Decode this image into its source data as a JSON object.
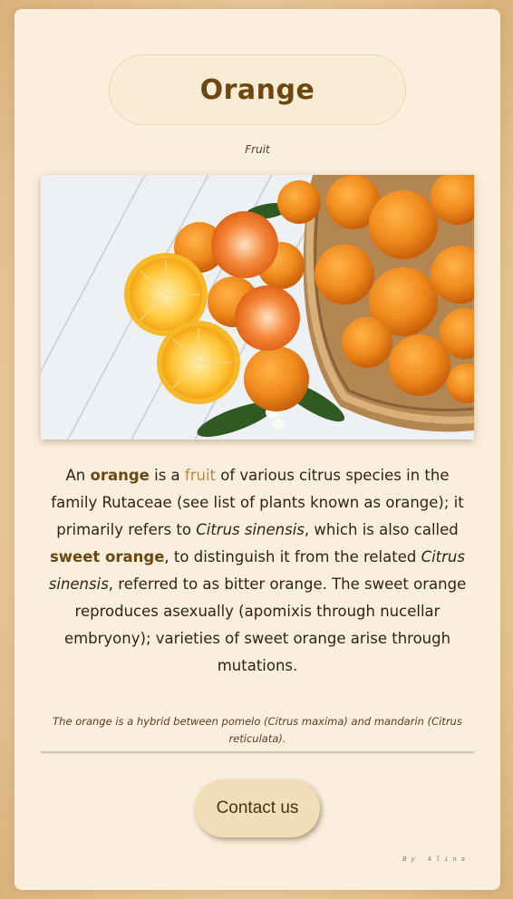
{
  "header": {
    "title": "Orange",
    "subtitle": "Fruit"
  },
  "image": {
    "alt_subject": "orange-fruits-basket"
  },
  "description": {
    "p1": "An ",
    "b1": "orange",
    "p2": " is a ",
    "link": "fruit",
    "p3": " of various citrus species in the family Rutaceae (see list of plants known as orange); it primarily refers to ",
    "i1": "Citrus sinensis",
    "p4": ", which is also called ",
    "b2": "sweet orange",
    "p5": ", to distinguish it from the related ",
    "i2": "Citrus sinensis",
    "p6": ", referred to as bitter orange. The sweet orange reproduces asexually (apomixis through nucellar embryony); varieties of sweet orange arise through mutations."
  },
  "footnote": "The orange is a hybrid between pomelo (Citrus maxima) and mandarin (Citrus reticulata).",
  "contact": {
    "label": "Contact us"
  },
  "byline": "By Alina",
  "colors": {
    "accent": "#6b4714",
    "link": "#b88a3c",
    "card": "#faeedc",
    "button": "#f0deb7"
  }
}
